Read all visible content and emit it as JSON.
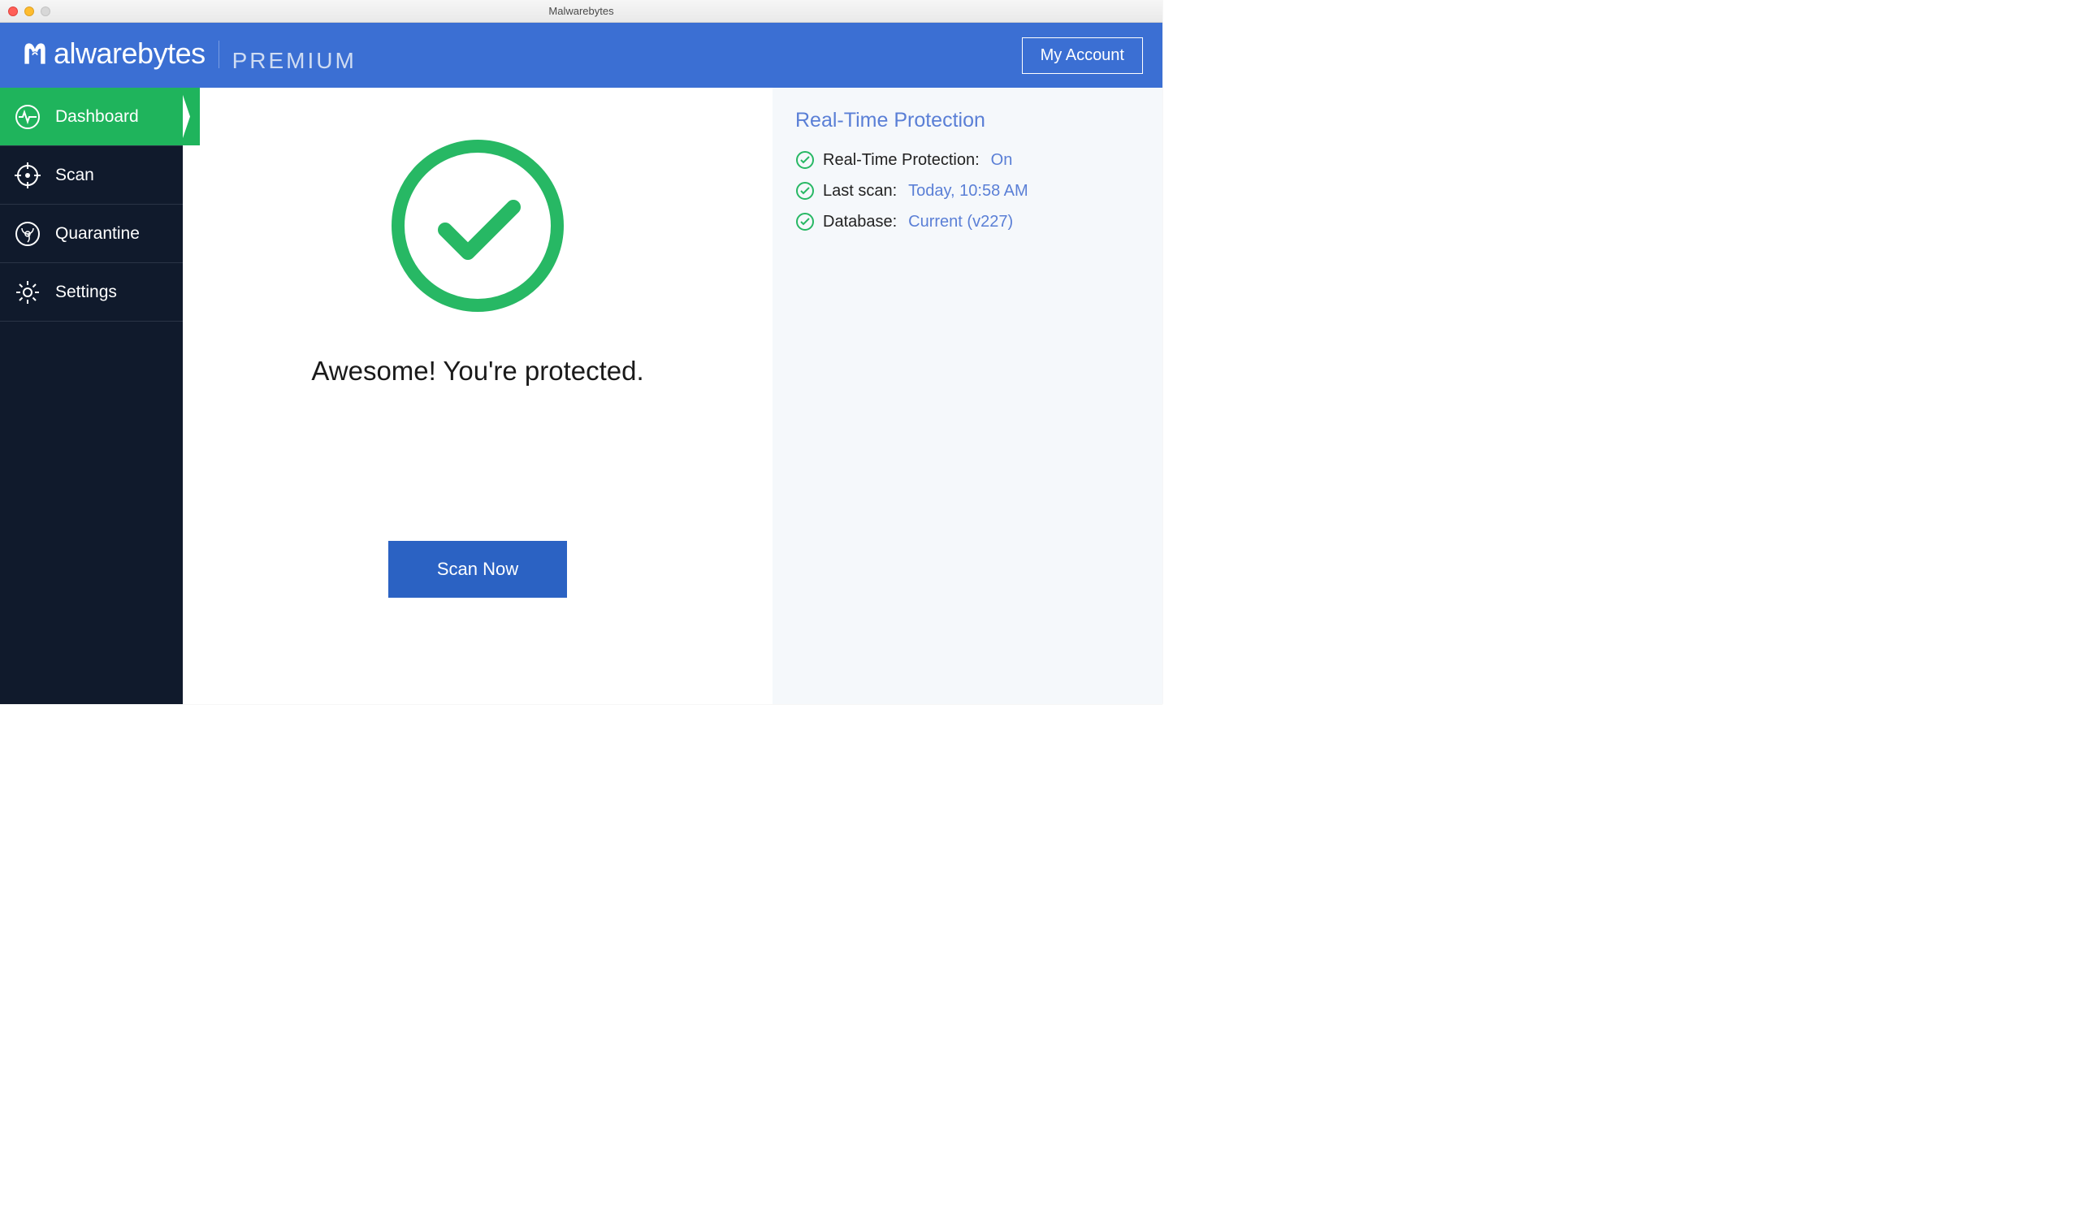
{
  "window": {
    "title": "Malwarebytes"
  },
  "header": {
    "brand_text": "alwarebytes",
    "tier": "PREMIUM",
    "my_account": "My Account"
  },
  "sidebar": {
    "items": [
      {
        "label": "Dashboard",
        "icon": "heartbeat-icon",
        "active": true
      },
      {
        "label": "Scan",
        "icon": "target-icon",
        "active": false
      },
      {
        "label": "Quarantine",
        "icon": "biohazard-icon",
        "active": false
      },
      {
        "label": "Settings",
        "icon": "gear-icon",
        "active": false
      }
    ]
  },
  "main": {
    "headline": "Awesome! You're protected.",
    "scan_button": "Scan Now"
  },
  "rightpanel": {
    "title": "Real-Time Protection",
    "rows": [
      {
        "label": "Real-Time Protection:",
        "value": "On"
      },
      {
        "label": "Last scan:",
        "value": "Today, 10:58 AM"
      },
      {
        "label": "Database:",
        "value": "Current (v227)"
      }
    ]
  },
  "colors": {
    "accent_blue": "#3b6fd3",
    "button_blue": "#2b62c3",
    "sidebar_bg": "#101a2c",
    "active_green": "#1fb45c",
    "check_green": "#27b864",
    "link_blue": "#5a7fd6"
  }
}
